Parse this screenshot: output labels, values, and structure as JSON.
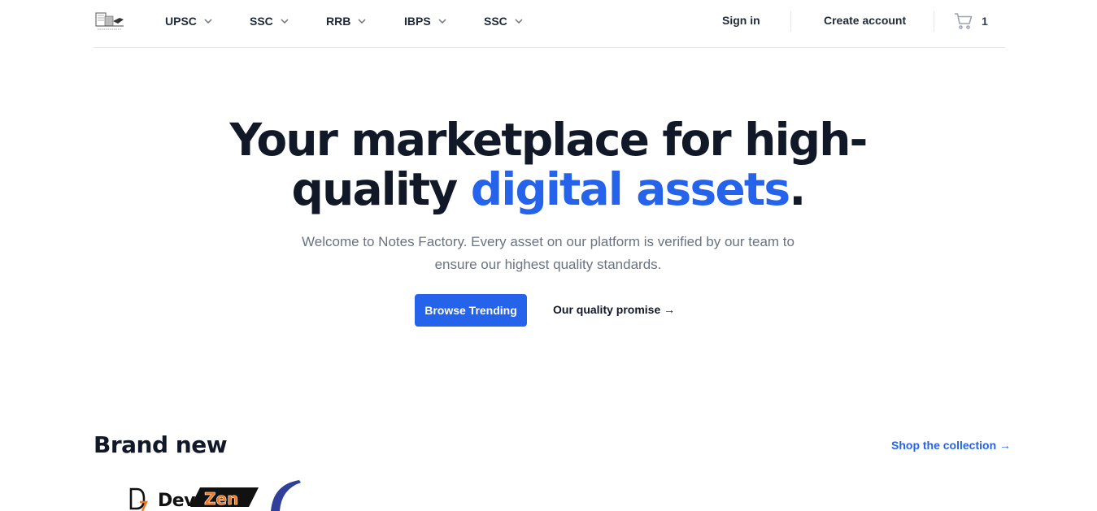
{
  "header": {
    "logo_alt": "Notes Factory",
    "nav": [
      {
        "label": "UPSC"
      },
      {
        "label": "SSC"
      },
      {
        "label": "RRB"
      },
      {
        "label": "IBPS"
      },
      {
        "label": "SSC"
      }
    ],
    "sign_in": "Sign in",
    "create_account": "Create account",
    "cart_count": "1"
  },
  "hero": {
    "title_part1": "Your marketplace for high-quality ",
    "title_accent": "digital assets",
    "title_end": ".",
    "subtitle": "Welcome to Notes Factory. Every asset on our platform is verified by our team to ensure our highest quality standards.",
    "primary_button": "Browse Trending",
    "secondary_link": "Our quality promise →"
  },
  "brand_new": {
    "title": "Brand new",
    "shop_link": "Shop the collection →",
    "product_logo_text_1": "Dev",
    "product_logo_text_2": "Zen"
  },
  "colors": {
    "accent": "#2563eb",
    "text": "#111827",
    "muted": "#6b7280",
    "border": "#e5e7eb",
    "product_orange": "#f97316"
  },
  "icons": {
    "nav_chevron": "chevron-down-icon",
    "cart": "shopping-cart-icon"
  }
}
